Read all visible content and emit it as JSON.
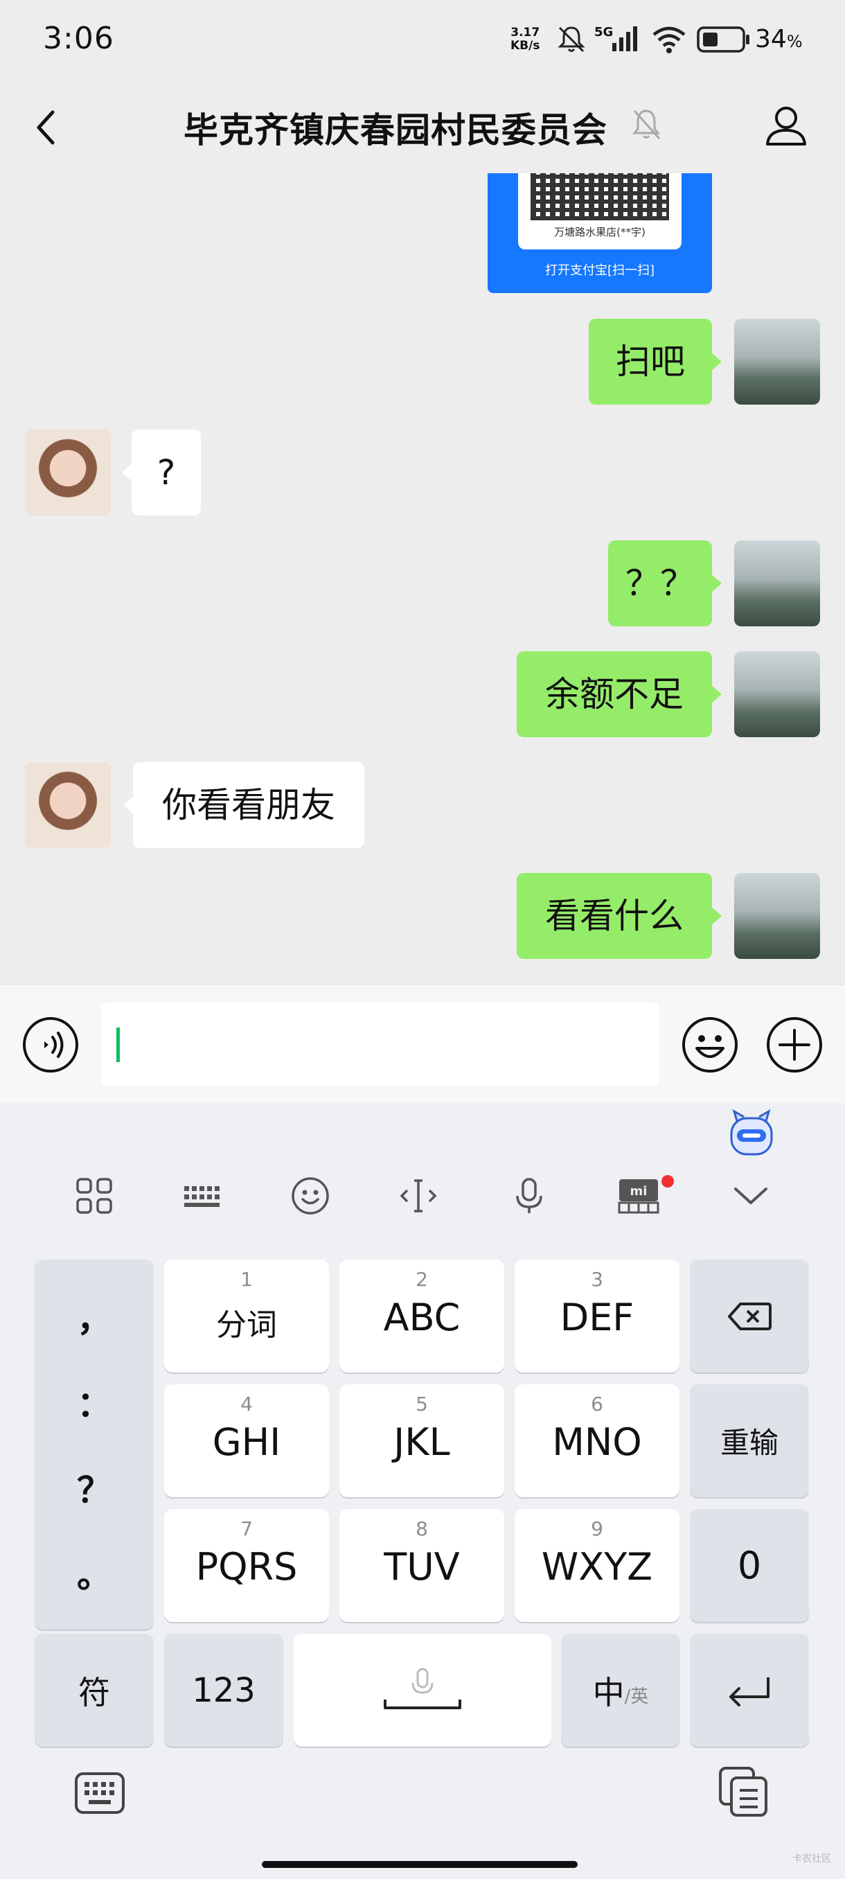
{
  "status_bar": {
    "time": "3:06",
    "net_speed_value": "3.17",
    "net_speed_unit": "KB/s",
    "network": "5G",
    "battery_percent": "34",
    "battery_unit": "%"
  },
  "header": {
    "title": "毕克齐镇庆春园村民委员会",
    "icons": [
      "back-icon",
      "mute-bell-icon",
      "person-icon"
    ]
  },
  "messages": [
    {
      "side": "right",
      "type": "image",
      "store_name": "万塘路水果店(**宇)",
      "hint": "打开支付宝[扫一扫]"
    },
    {
      "side": "right",
      "text": "扫吧"
    },
    {
      "side": "left",
      "text": "?"
    },
    {
      "side": "right",
      "text": "？？"
    },
    {
      "side": "right",
      "text": "余额不足"
    },
    {
      "side": "left",
      "text": "你看看朋友"
    },
    {
      "side": "right",
      "text": "看看什么"
    }
  ],
  "input_bar": {
    "value": "",
    "icons": [
      "voice-icon",
      "emoji-icon",
      "plus-icon"
    ]
  },
  "keyboard": {
    "toolbar_icons": [
      "grid-icon",
      "keyboard-layout-icon",
      "emoji-face-icon",
      "cursor-icon",
      "mic-icon",
      "mi-shop-icon",
      "collapse-chevron-icon"
    ],
    "punctuation": [
      "，",
      "：",
      "？",
      "。"
    ],
    "rows": [
      [
        {
          "num": "1",
          "label": "分词"
        },
        {
          "num": "2",
          "label": "ABC"
        },
        {
          "num": "3",
          "label": "DEF"
        }
      ],
      [
        {
          "num": "4",
          "label": "GHI"
        },
        {
          "num": "5",
          "label": "JKL"
        },
        {
          "num": "6",
          "label": "MNO"
        }
      ],
      [
        {
          "num": "7",
          "label": "PQRS"
        },
        {
          "num": "8",
          "label": "TUV"
        },
        {
          "num": "9",
          "label": "WXYZ"
        }
      ]
    ],
    "backspace_icon": "backspace-icon",
    "reenter_label": "重输",
    "zero_label": "0",
    "symbol_label": "符",
    "numeric_label": "123",
    "space_icon": "mic-space-icon",
    "lang_main": "中",
    "lang_sub": "/英",
    "enter_icon": "enter-icon",
    "bottom_icons": [
      "keyboard-switch-icon",
      "clipboard-icon"
    ]
  },
  "watermark": "卡农社区"
}
